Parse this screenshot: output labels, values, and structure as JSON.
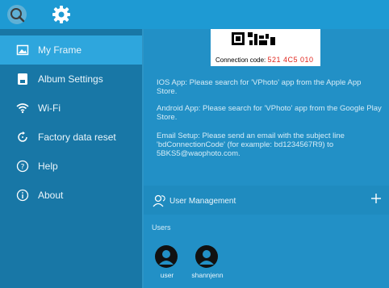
{
  "topbar": {
    "icons": [
      "search-icon",
      "gear-icon"
    ]
  },
  "sidebar": {
    "items": [
      {
        "label": "My Frame",
        "icon": "image-icon",
        "active": true
      },
      {
        "label": "Album Settings",
        "icon": "album-icon",
        "active": false
      },
      {
        "label": "Wi-Fi",
        "icon": "wifi-icon",
        "active": false
      },
      {
        "label": "Factory data reset",
        "icon": "reset-icon",
        "active": false
      },
      {
        "label": "Help",
        "icon": "help-icon",
        "active": false
      },
      {
        "label": "About",
        "icon": "info-icon",
        "active": false
      }
    ]
  },
  "connection": {
    "label": "Connection code:",
    "code": "521 4C5 010"
  },
  "instructions": {
    "ios": "IOS App: Please search for 'VPhoto' app from the Apple App Store.",
    "android": "Android App: Please search for 'VPhoto' app from the Google Play Store.",
    "email": "Email Setup: Please send an email with the subject line 'bdConnectionCode' (for example: bd1234567R9) to 5BKS5@waophoto.com."
  },
  "user_management": {
    "label": "User Management"
  },
  "users": {
    "header": "Users",
    "list": [
      {
        "name": "user"
      },
      {
        "name": "shannjenn"
      }
    ]
  },
  "colors": {
    "topbar": "#1e9ad3",
    "sidebar": "#1877a6",
    "active": "#2ea6dd",
    "main": "#2290c6",
    "code_red": "#e0241b"
  }
}
